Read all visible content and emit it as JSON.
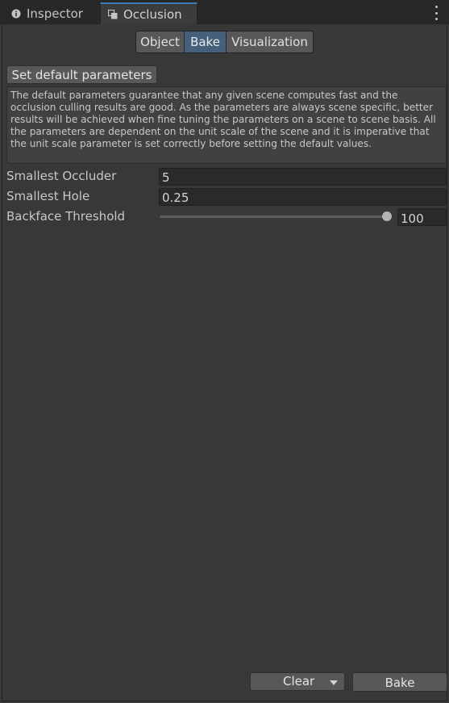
{
  "tabs": [
    {
      "label": "Inspector",
      "icon": "info-icon",
      "active": false
    },
    {
      "label": "Occlusion",
      "icon": "occlusion-icon",
      "active": true
    }
  ],
  "toolbar": {
    "modes": [
      "Object",
      "Bake",
      "Visualization"
    ],
    "selected": "Bake"
  },
  "set_default_button": "Set default parameters",
  "help_text": "The default parameters guarantee that any given scene computes fast and the occlusion culling results are good. As the parameters are always scene specific, better results will be achieved when fine tuning the parameters on a scene to scene basis. All the parameters are dependent on the unit scale of the scene and it is imperative that the unit scale parameter is set correctly before setting the default values.",
  "fields": {
    "smallest_occluder": {
      "label": "Smallest Occluder",
      "value": "5"
    },
    "smallest_hole": {
      "label": "Smallest Hole",
      "value": "0.25"
    },
    "backface_threshold": {
      "label": "Backface Threshold",
      "value": "100",
      "slider_fraction": 1.0
    }
  },
  "footer": {
    "clear_label": "Clear",
    "bake_label": "Bake"
  },
  "colors": {
    "accent_tab": "#3a79bb",
    "selected_segment": "#46607c",
    "panel_bg": "#383838"
  }
}
